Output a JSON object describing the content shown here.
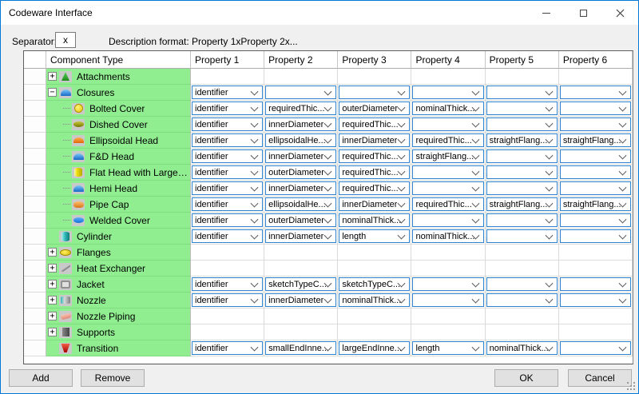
{
  "window": {
    "title": "Codeware Interface"
  },
  "colors": {
    "accent_blue": "#0078D7",
    "row_green": "#90EE90",
    "combo_border": "#2D83CE",
    "dialog_bg": "#F0F0F0"
  },
  "toolbar": {
    "separator_label": "Separator:",
    "separator_value": "x",
    "description_format": "Description format: Property 1xProperty 2x..."
  },
  "table": {
    "columns": [
      "Component Type",
      "Property 1",
      "Property 2",
      "Property 3",
      "Property 4",
      "Property 5",
      "Property 6"
    ],
    "rows": [
      {
        "label": "Attachments",
        "level": 0,
        "expander": "+",
        "icon": "attachments",
        "props": [
          null,
          null,
          null,
          null,
          null,
          null
        ]
      },
      {
        "label": "Closures",
        "level": 0,
        "expander": "-",
        "icon": "closures",
        "props": [
          "identifier",
          "",
          "",
          "",
          "",
          ""
        ]
      },
      {
        "label": "Bolted Cover",
        "level": 1,
        "expander": null,
        "icon": "bolted-cover",
        "props": [
          "identifier",
          "requiredThic...",
          "outerDiameter",
          "nominalThick...",
          "",
          ""
        ]
      },
      {
        "label": "Dished Cover",
        "level": 1,
        "expander": null,
        "icon": "dished-cover",
        "props": [
          "identifier",
          "innerDiameter",
          "requiredThic...",
          "",
          "",
          ""
        ]
      },
      {
        "label": "Ellipsoidal Head",
        "level": 1,
        "expander": null,
        "icon": "ellipsoidal-head",
        "props": [
          "identifier",
          "ellipsoidalHe...",
          "innerDiameter",
          "requiredThic...",
          "straightFlang...",
          "straightFlang..."
        ]
      },
      {
        "label": "F&D Head",
        "level": 1,
        "expander": null,
        "icon": "fd-head",
        "props": [
          "identifier",
          "innerDiameter",
          "requiredThic...",
          "straightFlang...",
          "",
          ""
        ]
      },
      {
        "label": "Flat Head with Large Ce...",
        "level": 1,
        "expander": null,
        "icon": "flat-head",
        "props": [
          "identifier",
          "outerDiameter",
          "requiredThic...",
          "",
          "",
          ""
        ]
      },
      {
        "label": "Hemi Head",
        "level": 1,
        "expander": null,
        "icon": "hemi-head",
        "props": [
          "identifier",
          "innerDiameter",
          "requiredThic...",
          "",
          "",
          ""
        ]
      },
      {
        "label": "Pipe Cap",
        "level": 1,
        "expander": null,
        "icon": "pipe-cap",
        "props": [
          "identifier",
          "ellipsoidalHe...",
          "innerDiameter",
          "requiredThic...",
          "straightFlang...",
          "straightFlang..."
        ]
      },
      {
        "label": "Welded Cover",
        "level": 1,
        "expander": null,
        "icon": "welded-cover",
        "props": [
          "identifier",
          "outerDiameter",
          "nominalThick...",
          "",
          "",
          ""
        ]
      },
      {
        "label": "Cylinder",
        "level": 0,
        "expander": null,
        "icon": "cylinder",
        "props": [
          "identifier",
          "innerDiameter",
          "length",
          "nominalThick...",
          "",
          ""
        ]
      },
      {
        "label": "Flanges",
        "level": 0,
        "expander": "+",
        "icon": "flanges",
        "props": [
          null,
          null,
          null,
          null,
          null,
          null
        ]
      },
      {
        "label": "Heat Exchanger",
        "level": 0,
        "expander": "+",
        "icon": "heat-exchanger",
        "props": [
          null,
          null,
          null,
          null,
          null,
          null
        ]
      },
      {
        "label": "Jacket",
        "level": 0,
        "expander": "+",
        "icon": "jacket",
        "props": [
          "identifier",
          "sketchTypeC...",
          "sketchTypeC...",
          "",
          "",
          ""
        ]
      },
      {
        "label": "Nozzle",
        "level": 0,
        "expander": "+",
        "icon": "nozzle",
        "props": [
          "identifier",
          "innerDiameter",
          "nominalThick...",
          "",
          "",
          ""
        ]
      },
      {
        "label": "Nozzle Piping",
        "level": 0,
        "expander": "+",
        "icon": "nozzle-piping",
        "props": [
          null,
          null,
          null,
          null,
          null,
          null
        ]
      },
      {
        "label": "Supports",
        "level": 0,
        "expander": "+",
        "icon": "supports",
        "props": [
          null,
          null,
          null,
          null,
          null,
          null
        ]
      },
      {
        "label": "Transition",
        "level": 0,
        "expander": null,
        "icon": "transition",
        "props": [
          "identifier",
          "smallEndInne...",
          "largeEndInne...",
          "length",
          "nominalThick...",
          ""
        ]
      }
    ]
  },
  "buttons": {
    "add": "Add",
    "remove": "Remove",
    "ok": "OK",
    "cancel": "Cancel"
  }
}
